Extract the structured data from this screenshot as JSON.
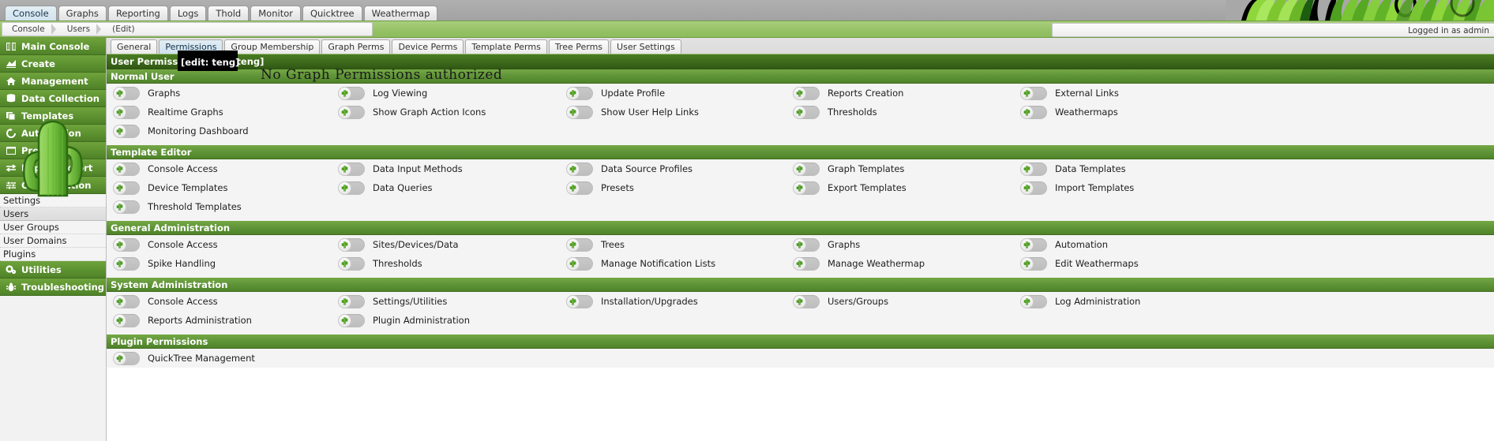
{
  "topbar": {
    "tabs": [
      {
        "label": "Console",
        "active": true
      },
      {
        "label": "Graphs",
        "active": false
      },
      {
        "label": "Reporting",
        "active": false
      },
      {
        "label": "Logs",
        "active": false
      },
      {
        "label": "Thold",
        "active": false
      },
      {
        "label": "Monitor",
        "active": false
      },
      {
        "label": "Quicktree",
        "active": false
      },
      {
        "label": "Weathermap",
        "active": false
      }
    ]
  },
  "breadcrumb": {
    "items": [
      "Console",
      "Users",
      "(Edit)"
    ],
    "login_status": "Logged in as admin"
  },
  "sidebar": {
    "main_items": [
      {
        "label": "Main Console",
        "icon": "book-icon"
      },
      {
        "label": "Create",
        "icon": "chart-icon"
      },
      {
        "label": "Management",
        "icon": "home-icon"
      },
      {
        "label": "Data Collection",
        "icon": "database-icon"
      },
      {
        "label": "Templates",
        "icon": "copy-icon"
      },
      {
        "label": "Automation",
        "icon": "refresh-icon"
      },
      {
        "label": "Presets",
        "icon": "window-icon"
      },
      {
        "label": "Import/Export",
        "icon": "exchange-icon"
      },
      {
        "label": "Configuration",
        "icon": "sliders-icon"
      }
    ],
    "sub_items": [
      {
        "label": "Settings",
        "selected": false
      },
      {
        "label": "Users",
        "selected": true
      },
      {
        "label": "User Groups",
        "selected": false
      },
      {
        "label": "User Domains",
        "selected": false
      },
      {
        "label": "Plugins",
        "selected": false
      }
    ],
    "tail_items": [
      {
        "label": "Utilities",
        "icon": "gears-icon"
      },
      {
        "label": "Troubleshooting",
        "icon": "bug-icon"
      }
    ],
    "logo": "cactus-logo"
  },
  "subtabs": [
    {
      "label": "General",
      "active": false
    },
    {
      "label": "Permissions",
      "active": true
    },
    {
      "label": "Group Membership",
      "active": false
    },
    {
      "label": "Graph Perms",
      "active": false
    },
    {
      "label": "Device Perms",
      "active": false
    },
    {
      "label": "Template Perms",
      "active": false
    },
    {
      "label": "Tree Perms",
      "active": false
    },
    {
      "label": "User Settings",
      "active": false
    }
  ],
  "panel": {
    "title": "User Permissions",
    "edit_tag": "[edit: teng]",
    "annotation": "No Graph Permissions authorized"
  },
  "sections": [
    {
      "name": "Normal User",
      "rows": [
        [
          "Graphs",
          "Log Viewing",
          "Update Profile",
          "Reports Creation",
          "External Links"
        ],
        [
          "Realtime Graphs",
          "Show Graph Action Icons",
          "Show User Help Links",
          "Thresholds",
          "Weathermaps"
        ],
        [
          "Monitoring Dashboard",
          "",
          "",
          "",
          ""
        ]
      ]
    },
    {
      "name": "Template Editor",
      "rows": [
        [
          "Console Access",
          "Data Input Methods",
          "Data Source Profiles",
          "Graph Templates",
          "Data Templates"
        ],
        [
          "Device Templates",
          "Data Queries",
          "Presets",
          "Export Templates",
          "Import Templates"
        ],
        [
          "Threshold Templates",
          "",
          "",
          "",
          ""
        ]
      ]
    },
    {
      "name": "General Administration",
      "rows": [
        [
          "Console Access",
          "Sites/Devices/Data",
          "Trees",
          "Graphs",
          "Automation"
        ],
        [
          "Spike Handling",
          "Thresholds",
          "Manage Notification Lists",
          "Manage Weathermap",
          "Edit Weathermaps"
        ]
      ]
    },
    {
      "name": "System Administration",
      "rows": [
        [
          "Console Access",
          "Settings/Utilities",
          "Installation/Upgrades",
          "Users/Groups",
          "Log Administration"
        ],
        [
          "Reports Administration",
          "Plugin Administration",
          "",
          "",
          ""
        ]
      ]
    },
    {
      "name": "Plugin Permissions",
      "rows": [
        [
          "QuickTree Management",
          "",
          "",
          "",
          ""
        ]
      ]
    }
  ],
  "colors": {
    "accent_green": "#5e9331",
    "dark_green": "#3d6a1b",
    "section_green": "#61953a",
    "toolbar_gray": "#a8a8a8",
    "crumb_green": "#97c267"
  }
}
